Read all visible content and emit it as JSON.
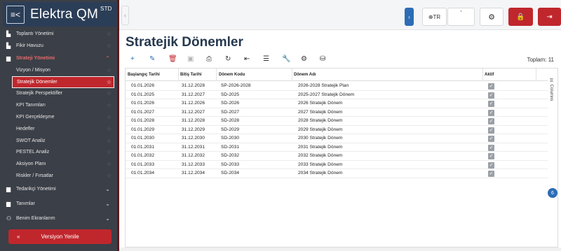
{
  "brand": {
    "name": "Elektra QM",
    "sup": "STD",
    "menu_glyph": "≡<"
  },
  "sidebar": {
    "items": [
      {
        "label": "Toplantı Yönetimi",
        "icon": "building-icon",
        "glyph": "▙",
        "kind": "star"
      },
      {
        "label": "Fikir Havuzu",
        "icon": "building-icon",
        "glyph": "▙",
        "kind": "star"
      },
      {
        "label": "Strateji Yönetimi",
        "icon": "folder-icon",
        "glyph": "▆",
        "kind": "group-open"
      }
    ],
    "subitems": [
      {
        "label": "Vizyon / Misyon"
      },
      {
        "label": "Stratejik Dönemler",
        "active": true
      },
      {
        "label": "Stratejik Perspektifler"
      },
      {
        "label": "KPI Tanımları"
      },
      {
        "label": "KPI Gerçekleşme"
      },
      {
        "label": "Hedefler"
      },
      {
        "label": "SWOT Analiz"
      },
      {
        "label": "PESTEL Analiz"
      },
      {
        "label": "Aksiyon Planı"
      },
      {
        "label": "Riskler / Fırsatlar"
      }
    ],
    "groups": [
      {
        "label": "Tedarikçi Yönetimi",
        "icon": "folder-icon",
        "glyph": "▆"
      },
      {
        "label": "Tanımlar",
        "icon": "folder-icon",
        "glyph": "▆"
      },
      {
        "label": "Benim Ekranlarım",
        "icon": "users-icon",
        "glyph": "⚇"
      }
    ],
    "refresh_label": "Versiyon Yenile",
    "refresh_icon": "double-chevron-up-icon"
  },
  "topbar": {
    "lang": "TR",
    "blank_mark": "'"
  },
  "page": {
    "title": "Stratejik Dönemler",
    "total_label": "Toplam: 11"
  },
  "toolbar": [
    {
      "name": "add-icon",
      "glyph": "+",
      "tone": "blue"
    },
    {
      "name": "edit-icon",
      "glyph": "✎",
      "tone": "blue"
    },
    {
      "name": "delete-icon",
      "glyph": "🗑",
      "tone": "red"
    },
    {
      "name": "save-icon",
      "glyph": "▣",
      "tone": "grey"
    },
    {
      "name": "print-icon",
      "glyph": "⎙",
      "tone": ""
    },
    {
      "name": "refresh-icon",
      "glyph": "↻",
      "tone": ""
    },
    {
      "name": "export-excel-icon",
      "glyph": "⇤",
      "tone": ""
    },
    {
      "name": "filter-icon",
      "glyph": "☰",
      "tone": ""
    },
    {
      "name": "wrench-icon",
      "glyph": "🔧",
      "tone": ""
    },
    {
      "name": "settings-icon",
      "glyph": "⚙",
      "tone": ""
    },
    {
      "name": "database-icon",
      "glyph": "⛁",
      "tone": ""
    }
  ],
  "table": {
    "headers": [
      "Başlangıç Tarihi",
      "Bitiş Tarihi",
      "Dönem Kodu",
      "Dönem Adı",
      "Aktif"
    ],
    "columns_label": "☰ Columns",
    "rows": [
      [
        "01.01.2026",
        "31.12.2028",
        "SP-2026-2028",
        "2026-2028 Stratejik Plan"
      ],
      [
        "01.01.2025",
        "31.12.2027",
        "SD-2025",
        "2025-2027 Stratejik Dönem"
      ],
      [
        "01.01.2026",
        "31.12.2026",
        "SD-2026",
        "2026 Stratejik Dönem"
      ],
      [
        "01.01.2027",
        "31.12.2027",
        "SD-2027",
        "2027 Stratejik Dönem"
      ],
      [
        "01.01.2028",
        "31.12.2028",
        "SD-2028",
        "2028 Stratejik Dönem"
      ],
      [
        "01.01.2029",
        "31.12.2029",
        "SD-2029",
        "2029 Stratejik Dönem"
      ],
      [
        "01.01.2030",
        "31.12.2030",
        "SD-2030",
        "2030 Stratejik Dönem"
      ],
      [
        "01.01.2031",
        "31.12.2031",
        "SD-2031",
        "2031 Stratejik Dönem"
      ],
      [
        "01.01.2032",
        "31.12.2032",
        "SD-2032",
        "2032 Stratejik Dönem"
      ],
      [
        "01.01.2033",
        "31.12.2033",
        "SD-2033",
        "2033 Stratejik Dönem"
      ],
      [
        "01.01.2034",
        "31.12.2034",
        "SD-2034",
        "2034 Stratejik Dönem"
      ]
    ],
    "active_glyph": "✓"
  },
  "notification": {
    "count": "6"
  },
  "colors": {
    "accent": "#c0272d",
    "brand": "#2b3e57",
    "sidebar": "#3b3f47",
    "primary": "#2c6db5"
  }
}
